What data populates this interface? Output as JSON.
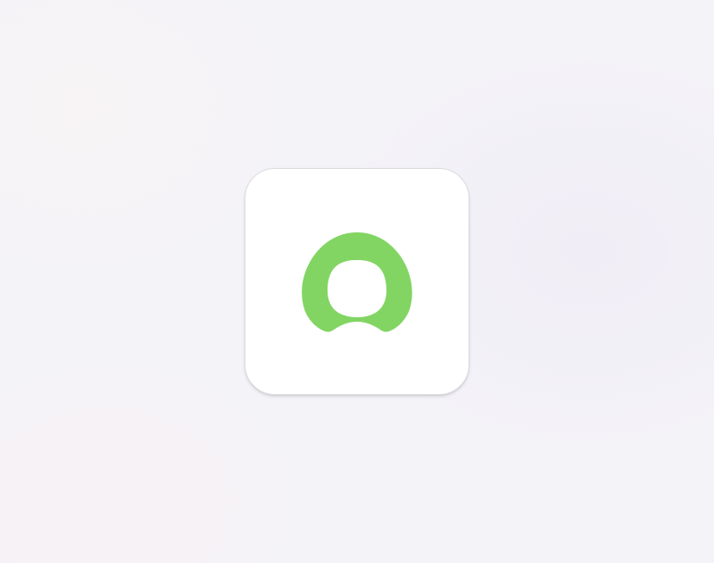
{
  "app_tile": {
    "icon": "user-profile-icon",
    "tile_background": "#ffffff",
    "icon_color": "#82d563"
  },
  "background": {
    "color": "#f4f3f8"
  }
}
